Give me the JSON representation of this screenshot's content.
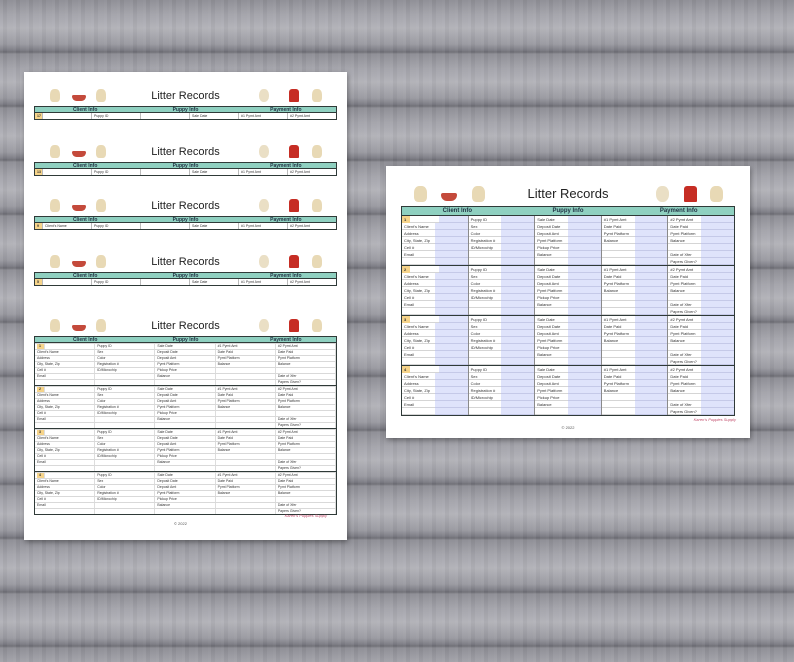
{
  "title": "Litter Records",
  "columns": [
    "Client Info",
    "Puppy Info",
    "Payment Info"
  ],
  "copyright": "© 2022",
  "brand": "Karen's Puppies Supply",
  "colors": {
    "header": "#8fd0c0",
    "number": "#f6d48a",
    "input": "#dfe3fb"
  },
  "icons": [
    "dog-icon",
    "bowl-icon",
    "dog-icon",
    "bunny-icon",
    "hydrant-icon",
    "dog-icon"
  ],
  "left_sheet": {
    "bands": [
      {
        "row_num": "17",
        "cells": [
          "",
          "Puppy ID",
          "",
          "Sale Date",
          "#1 Pymt Amt",
          "#2 Pymt Amt"
        ]
      },
      {
        "row_num": "13",
        "cells": [
          "",
          "Puppy ID",
          "",
          "Sale Date",
          "#1 Pymt Amt",
          "#2 Pymt Amt"
        ]
      },
      {
        "row_num": "9",
        "cells": [
          "Client's Name",
          "Puppy ID",
          "",
          "Sale Date",
          "#1 Pymt Amt",
          "#2 Pymt Amt"
        ]
      },
      {
        "row_num": "5",
        "cells": [
          "",
          "Puppy ID",
          "",
          "Sale Date",
          "#1 Pymt Amt",
          "#2 Pymt Amt"
        ]
      }
    ],
    "detail_numbers": [
      "1",
      "2",
      "3",
      "4"
    ]
  },
  "fields": {
    "client": [
      "Client's Name",
      "Address",
      "City, State, Zip",
      "Cell #",
      "Email"
    ],
    "puppy": [
      "Puppy ID",
      "Sex",
      "Color",
      "Registration #",
      "ID/Microchip"
    ],
    "sale": [
      "Sale Date",
      "Deposit Date",
      "Deposit Amt",
      "Pymt Platform",
      "Pickup Price",
      "Balance"
    ],
    "payment_a": [
      "#1 Pymt Amt",
      "Date Paid",
      "Pymt Platform",
      "Balance"
    ],
    "payment_b": [
      "#2 Pymt Amt",
      "Date Paid",
      "Pymt Platform",
      "Balance",
      "",
      "Date of Xfer",
      "Papers Given?"
    ]
  },
  "right_sheet": {
    "block_numbers": [
      "1",
      "2",
      "3",
      "4"
    ]
  }
}
